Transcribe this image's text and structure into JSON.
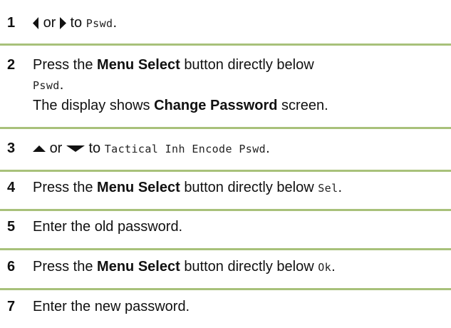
{
  "steps": [
    {
      "num": "1",
      "left_icon": "arrow-left-icon",
      "or": "or",
      "right_icon": "arrow-right-icon",
      "to": "to",
      "target": "Pswd",
      "end": "."
    },
    {
      "num": "2",
      "pre": "Press the",
      "bold": "Menu Select",
      "post": "button directly below",
      "target": "Pswd",
      "end": ".",
      "line2_pre": "The display shows",
      "line2_bold": "Change Password",
      "line2_post": "screen."
    },
    {
      "num": "3",
      "up_icon": "arrow-up-icon",
      "or": "or",
      "down_icon": "arrow-down-icon",
      "to": "to",
      "target": "Tactical Inh Encode Pswd",
      "end": "."
    },
    {
      "num": "4",
      "pre": "Press the",
      "bold": "Menu Select",
      "post": "button directly below",
      "target": "Sel",
      "end": "."
    },
    {
      "num": "5",
      "text": "Enter the old password."
    },
    {
      "num": "6",
      "pre": "Press the",
      "bold": "Menu Select",
      "post": "button directly below",
      "target": "Ok",
      "end": "."
    },
    {
      "num": "7",
      "text": "Enter the new password."
    }
  ],
  "colors": {
    "divider": "#a8c17a",
    "text": "#111111"
  }
}
